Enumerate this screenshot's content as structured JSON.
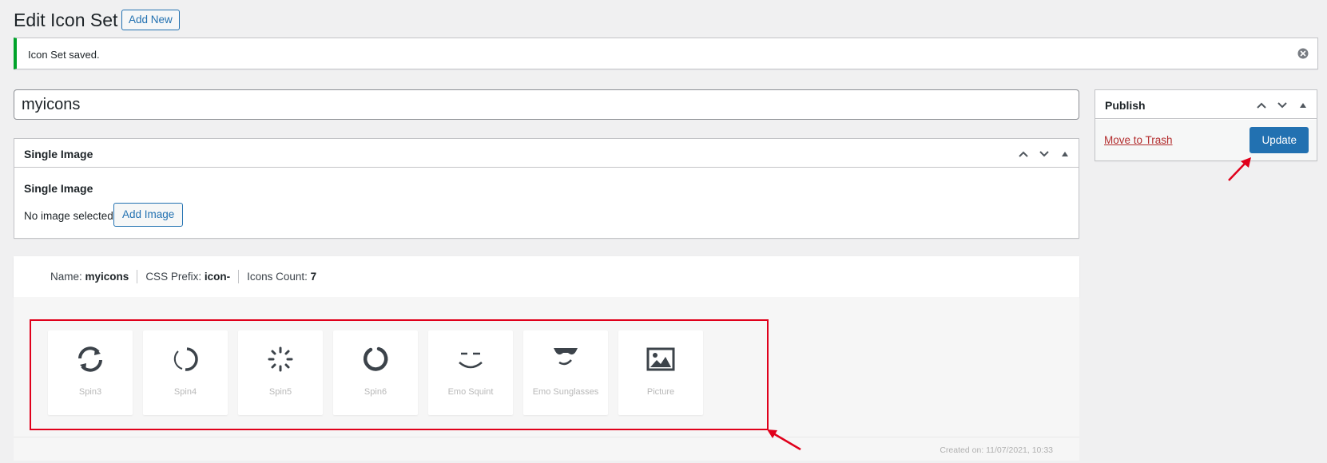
{
  "header": {
    "title": "Edit Icon Set",
    "add_new_label": "Add New"
  },
  "notice": {
    "text": "Icon Set saved."
  },
  "title_field": {
    "value": "myicons"
  },
  "single_image_box": {
    "title": "Single Image",
    "field_label": "Single Image",
    "status_text": "No image selected",
    "add_button_label": "Add Image"
  },
  "publish_box": {
    "title": "Publish",
    "trash_label": "Move to Trash",
    "update_label": "Update"
  },
  "info": {
    "name_label": "Name:",
    "name_value": "myicons",
    "prefix_label": "CSS Prefix:",
    "prefix_value": "icon-",
    "count_label": "Icons Count:",
    "count_value": "7"
  },
  "icons": [
    {
      "name": "Spin3",
      "icon": "spin3-icon"
    },
    {
      "name": "Spin4",
      "icon": "spin4-icon"
    },
    {
      "name": "Spin5",
      "icon": "spin5-icon"
    },
    {
      "name": "Spin6",
      "icon": "spin6-icon"
    },
    {
      "name": "Emo Squint",
      "icon": "emo-squint-icon"
    },
    {
      "name": "Emo Sunglasses",
      "icon": "emo-sunglasses-icon"
    },
    {
      "name": "Picture",
      "icon": "picture-icon"
    }
  ],
  "footer": {
    "created_text": "Created on: 11/07/2021, 10:33"
  },
  "colors": {
    "accent": "#2271b1",
    "success": "#00a32a",
    "danger": "#b32d2e",
    "highlight": "#e0001b"
  }
}
